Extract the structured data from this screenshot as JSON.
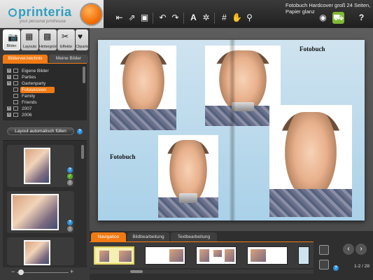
{
  "app": {
    "logo": "printeria",
    "tagline": "your personal printhouse",
    "document_title": "Fotobuch Hardcover groß 24 Seiten, Papier glanz"
  },
  "toolbar": {
    "icons": [
      "undo-all-icon",
      "export-icon",
      "save-icon",
      "undo-icon",
      "redo-icon",
      "text-add-icon",
      "effects-icon",
      "grid-icon",
      "hand-icon",
      "zoom-icon",
      "preview-icon",
      "cart-icon",
      "help-icon"
    ]
  },
  "left_panel": {
    "categories": [
      {
        "label": "Bilder",
        "icon": "camera-icon"
      },
      {
        "label": "Layouts",
        "icon": "layouts-icon"
      },
      {
        "label": "Hintergründe",
        "icon": "backgrounds-icon"
      },
      {
        "label": "Effekte",
        "icon": "effects-icon"
      },
      {
        "label": "Cliparts",
        "icon": "cliparts-icon"
      }
    ],
    "subtabs": [
      "Bilderverzeichnis",
      "Meine Bilder"
    ],
    "tree": [
      {
        "label": "Eigene Bilder",
        "expandable": true
      },
      {
        "label": "Parties",
        "expandable": true
      },
      {
        "label": "Gartenparty",
        "expandable": true
      },
      {
        "label": "Fotosession",
        "expandable": false,
        "selected": true
      },
      {
        "label": "Family",
        "expandable": false
      },
      {
        "label": "Friends",
        "expandable": false
      },
      {
        "label": "2007",
        "expandable": true
      },
      {
        "label": "2006",
        "expandable": true
      }
    ],
    "autofill_label": "Layout automatisch füllen",
    "help_glyph": "?",
    "ok_glyph": "✓",
    "info_glyph": "i"
  },
  "canvas": {
    "left_page_text": "Fotobuch",
    "right_page_text": "Fotobuch"
  },
  "bottom_panel": {
    "tabs": [
      "Navigation",
      "Bildbearbeitung",
      "Textbearbeitung"
    ],
    "page_counter": "1-2 / 28"
  },
  "colors": {
    "accent": "#f27a14",
    "brand": "#2f9fbf",
    "active_green": "#7fb935",
    "page_blue": "#a9d1e9"
  }
}
